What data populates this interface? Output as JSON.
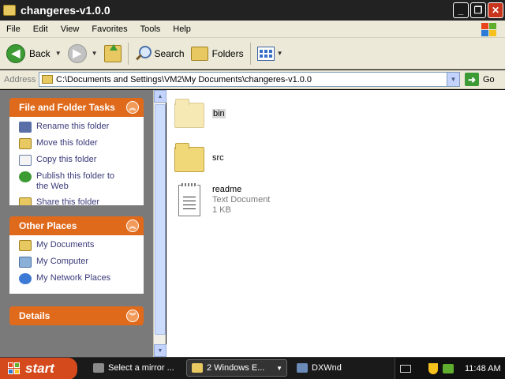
{
  "window": {
    "title": "changeres-v1.0.0",
    "buttons": {
      "minimize": "_",
      "maximize": "❐",
      "close": "✕"
    }
  },
  "menu": [
    "File",
    "Edit",
    "View",
    "Favorites",
    "Tools",
    "Help"
  ],
  "toolbar": {
    "back_label": "Back",
    "search_label": "Search",
    "folders_label": "Folders"
  },
  "address": {
    "label": "Address",
    "path": "C:\\Documents and Settings\\VM2\\My Documents\\changeres-v1.0.0",
    "go_label": "Go"
  },
  "tasks_panel": {
    "title": "File and Folder Tasks",
    "items": [
      {
        "label": "Rename this folder",
        "icon": "rename-icon"
      },
      {
        "label": "Move this folder",
        "icon": "move-icon"
      },
      {
        "label": "Copy this folder",
        "icon": "copy-icon"
      },
      {
        "label": "Publish this folder to the Web",
        "icon": "publish-icon"
      },
      {
        "label": "Share this folder",
        "icon": "share-icon"
      }
    ]
  },
  "other_places": {
    "title": "Other Places",
    "items": [
      {
        "label": "My Documents",
        "icon": "my-documents-icon"
      },
      {
        "label": "My Computer",
        "icon": "my-computer-icon"
      },
      {
        "label": "My Network Places",
        "icon": "my-network-icon"
      }
    ]
  },
  "details": {
    "title": "Details"
  },
  "files": [
    {
      "name": "bin",
      "type": "folder",
      "selected": true
    },
    {
      "name": "src",
      "type": "folder"
    },
    {
      "name": "readme",
      "type": "Text Document",
      "size": "1 KB"
    }
  ],
  "taskbar": {
    "start_label": "start",
    "tasks": [
      {
        "label": "Select a mirror ..."
      },
      {
        "label": "2 Windows E...",
        "active": true
      },
      {
        "label": "DXWnd"
      }
    ],
    "clock": "11:48 AM"
  },
  "colors": {
    "task_panel_header": "#e06a1c",
    "left_panel_bg": "#7a7a7a",
    "start_button": "#d44a1c"
  }
}
